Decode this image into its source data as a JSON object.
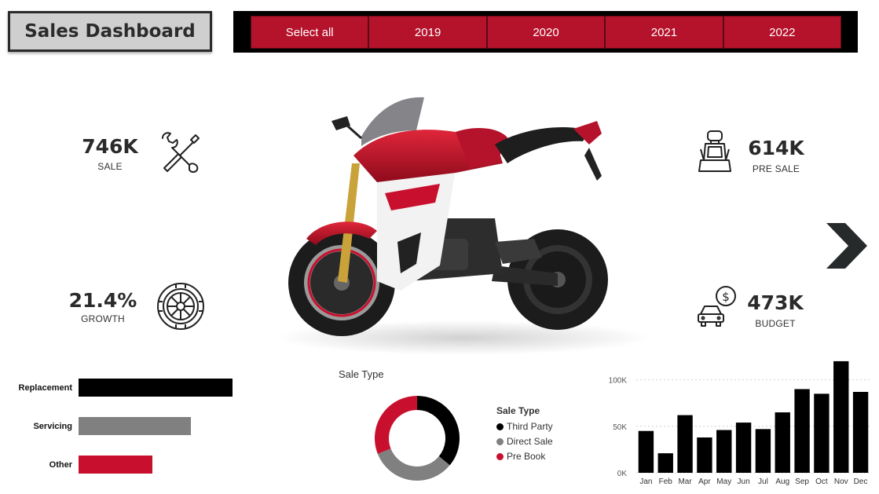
{
  "header": {
    "title": "Sales Dashboard"
  },
  "year_slicer": {
    "options": [
      "Select all",
      "2019",
      "2020",
      "2021",
      "2022"
    ],
    "color": "#b5122b"
  },
  "kpis": {
    "sale": {
      "value": "746K",
      "label": "SALE",
      "icon": "tools-icon"
    },
    "growth": {
      "value": "21.4%",
      "label": "GROWTH",
      "icon": "tire-icon"
    },
    "pre_sale": {
      "value": "614K",
      "label": "PRE SALE",
      "icon": "car-seat-icon"
    },
    "budget": {
      "value": "473K",
      "label": "BUDGET",
      "icon": "car-dollar-icon"
    }
  },
  "navigation": {
    "next_icon": "chevron-right-icon"
  },
  "colors": {
    "accent": "#c8102e",
    "dark": "#000000",
    "gray": "#808080"
  },
  "chart_data": [
    {
      "type": "bar",
      "orientation": "horizontal",
      "categories": [
        "Replacement",
        "Servicing",
        "Other"
      ],
      "values": [
        100,
        73,
        48
      ],
      "colors": [
        "#000000",
        "#808080",
        "#c8102e"
      ],
      "title": "",
      "xlabel": "",
      "ylabel": ""
    },
    {
      "type": "pie",
      "donut": true,
      "title": "Sale Type",
      "legend_title": "Sale Type",
      "labels": [
        "Third Party",
        "Direct Sale",
        "Pre Book"
      ],
      "values": [
        36,
        33,
        31
      ],
      "colors": [
        "#000000",
        "#808080",
        "#c8102e"
      ],
      "legend": "right"
    },
    {
      "type": "bar",
      "categories": [
        "Jan",
        "Feb",
        "Mar",
        "Apr",
        "May",
        "Jun",
        "Jul",
        "Aug",
        "Sep",
        "Oct",
        "Nov",
        "Dec"
      ],
      "values": [
        45000,
        21000,
        62000,
        38000,
        46000,
        54000,
        47000,
        65000,
        90000,
        85000,
        120000,
        87000
      ],
      "yticks": [
        "0K",
        "50K",
        "100K"
      ],
      "ylim": [
        0,
        125000
      ],
      "color": "#000000",
      "grid": true,
      "title": "",
      "xlabel": "",
      "ylabel": ""
    }
  ]
}
